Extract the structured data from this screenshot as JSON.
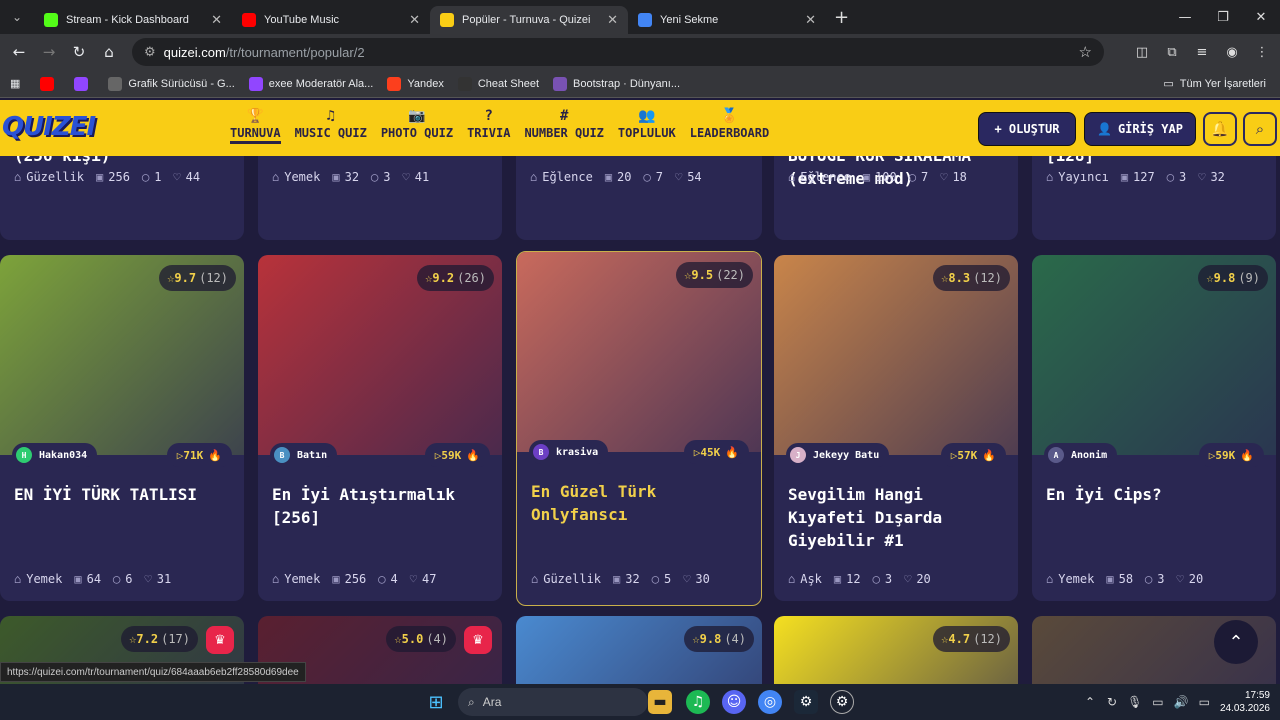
{
  "browser": {
    "tabs": [
      {
        "title": "Stream - Kick Dashboard",
        "icon": "kick-icon",
        "color": "#53fc18",
        "active": false
      },
      {
        "title": "YouTube Music",
        "icon": "youtube-music-icon",
        "color": "#ff0000",
        "active": false
      },
      {
        "title": "Popüler - Turnuva - Quizei",
        "icon": "quizei-icon",
        "color": "#f9cd15",
        "active": true
      },
      {
        "title": "Yeni Sekme",
        "icon": "chrome-icon",
        "color": "#4285f4",
        "active": false
      }
    ],
    "url_host": "quizei.com",
    "url_path": "/tr/tournament/popular/2",
    "bookmarks": [
      {
        "label": "",
        "icon": "youtube-icon",
        "color": "#ff0000"
      },
      {
        "label": "",
        "icon": "twitch-icon",
        "color": "#9146ff"
      },
      {
        "label": "Grafik Sürücüsü - G...",
        "icon": "chrome-icon",
        "color": "#666"
      },
      {
        "label": "exee Moderatör Ala...",
        "icon": "twitch-icon",
        "color": "#9146ff"
      },
      {
        "label": "Yandex",
        "icon": "yandex-icon",
        "color": "#fc3f1d"
      },
      {
        "label": "Cheat Sheet",
        "icon": "leaf-icon",
        "color": "#333"
      },
      {
        "label": "Bootstrap · Dünyanı...",
        "icon": "bootstrap-icon",
        "color": "#7952b3"
      }
    ],
    "bookmarks_all": "Tüm Yer İşaretleri",
    "status_url": "https://quizei.com/tr/tournament/quiz/684aaab6eb2ff28580d69dee"
  },
  "header": {
    "logo": "QUIZEI",
    "nav": [
      {
        "label": "TURNUVA",
        "icon": "trophy-icon",
        "glyph": "🏆",
        "active": true
      },
      {
        "label": "MUSIC QUIZ",
        "icon": "music-icon",
        "glyph": "♫",
        "active": false
      },
      {
        "label": "PHOTO QUIZ",
        "icon": "camera-icon",
        "glyph": "📷",
        "active": false
      },
      {
        "label": "TRIVIA",
        "icon": "question-icon",
        "glyph": "?",
        "active": false
      },
      {
        "label": "NUMBER QUIZ",
        "icon": "hash-icon",
        "glyph": "#",
        "active": false
      },
      {
        "label": "TOPLULUK",
        "icon": "users-icon",
        "glyph": "👥",
        "active": false
      },
      {
        "label": "LEADERBOARD",
        "icon": "award-icon",
        "glyph": "🏅",
        "active": false
      }
    ],
    "create_label": "+ OLUŞTUR",
    "login_label": "GİRİŞ YAP"
  },
  "top_row": [
    {
      "title": "(256 kişi)",
      "category": "Güzellik",
      "items": "256",
      "comments": "1",
      "likes": "44"
    },
    {
      "title": "",
      "category": "Yemek",
      "items": "32",
      "comments": "3",
      "likes": "41"
    },
    {
      "title": "",
      "category": "Eğlence",
      "items": "20",
      "comments": "7",
      "likes": "54"
    },
    {
      "title": "BÜYÜGE KÜR SIRALAMA (extreme mod)",
      "category": "Eğlence",
      "items": "100",
      "comments": "7",
      "likes": "18"
    },
    {
      "title": "[128]",
      "category": "Yayıncı",
      "items": "127",
      "comments": "3",
      "likes": "32"
    }
  ],
  "cards": [
    {
      "title": "EN İYİ TÜRK TATLISI",
      "rating": "9.7",
      "rating_count": "(12)",
      "author": "Hakan034",
      "author_initial": "H",
      "avatar_color": "#2ecc71",
      "plays": "71K",
      "category": "Yemek",
      "items": "64",
      "comments": "6",
      "likes": "31",
      "bg": "#7da33a"
    },
    {
      "title": "En İyi Atıştırmalık [256]",
      "rating": "9.2",
      "rating_count": "(26)",
      "author": "Batın",
      "author_initial": "B",
      "avatar_color": "#4a90c2",
      "plays": "59K",
      "category": "Yemek",
      "items": "256",
      "comments": "4",
      "likes": "47",
      "bg": "#b8323a"
    },
    {
      "title": "En Güzel Türk Onlyfanscı",
      "rating": "9.5",
      "rating_count": "(22)",
      "author": "krasiva",
      "author_initial": "B",
      "avatar_color": "#6c3fc4",
      "plays": "45K",
      "category": "Güzellik",
      "items": "32",
      "comments": "5",
      "likes": "30",
      "bg": "#c96a5c"
    },
    {
      "title": "Sevgilim Hangi Kıyafeti Dışarda Giyebilir #1",
      "rating": "8.3",
      "rating_count": "(12)",
      "author": "Jekeyy Batu",
      "author_initial": "J",
      "avatar_color": "#d8b0c8",
      "plays": "57K",
      "category": "Aşk",
      "items": "12",
      "comments": "3",
      "likes": "20",
      "bg": "#c9854a"
    },
    {
      "title": "En İyi Cips?",
      "rating": "9.8",
      "rating_count": "(9)",
      "author": "Anonim",
      "author_initial": "A",
      "avatar_color": "#5a5a8a",
      "plays": "59K",
      "category": "Yemek",
      "items": "58",
      "comments": "3",
      "likes": "20",
      "bg": "#2a6a4a"
    }
  ],
  "bottom_row": [
    {
      "rating": "7.2",
      "rating_count": "(17)",
      "crown": true,
      "bg": "#3d5a2a"
    },
    {
      "rating": "5.0",
      "rating_count": "(4)",
      "crown": true,
      "bg": "#5a2030"
    },
    {
      "rating": "9.8",
      "rating_count": "(4)",
      "crown": false,
      "bg": "#4a8ad0"
    },
    {
      "rating": "4.7",
      "rating_count": "(12)",
      "crown": false,
      "bg": "#f5e020"
    },
    {
      "rating": "",
      "rating_count": "",
      "crown": false,
      "bg": "#5a4a3a"
    }
  ],
  "taskbar": {
    "search_label": "Ara",
    "time": "17:59",
    "date": "24.03.2026"
  }
}
